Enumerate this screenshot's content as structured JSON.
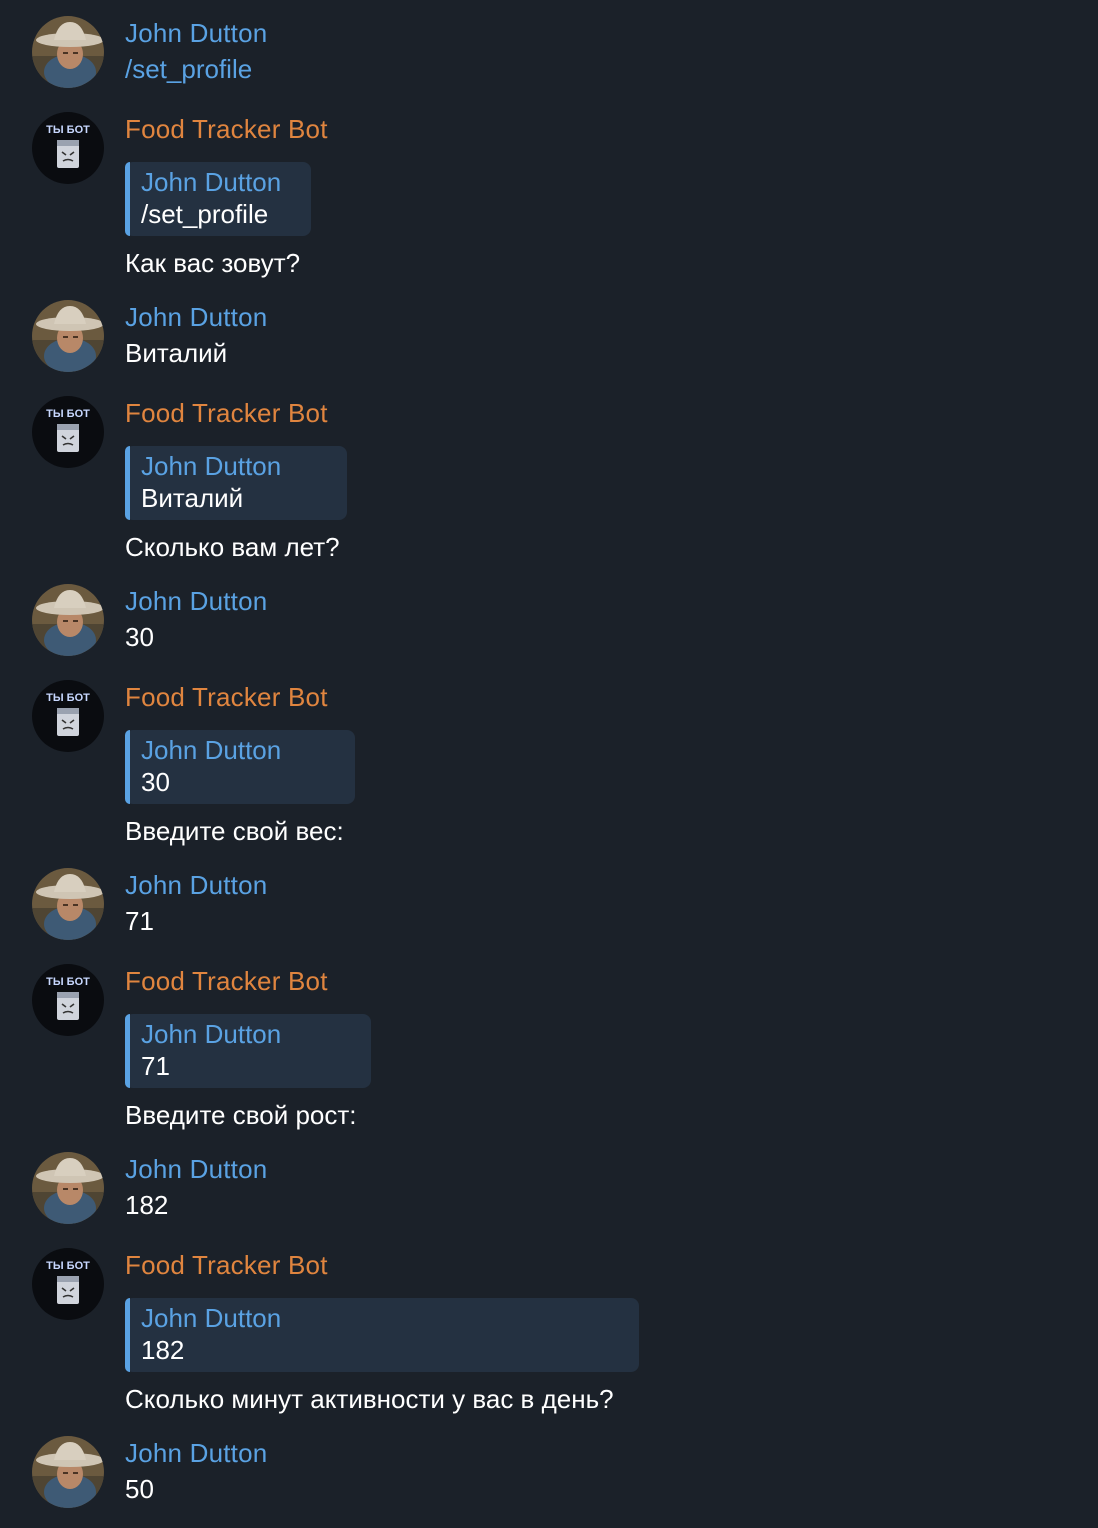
{
  "colors": {
    "background": "#1b2129",
    "user_name": "#5aa2e3",
    "bot_name": "#e0853f",
    "reply_bg": "#243141",
    "reply_bar": "#5aa2e3"
  },
  "avatars": {
    "user": "cowboy-avatar",
    "bot": "bot-avatar",
    "bot_badge": "ТЫ БОТ"
  },
  "messages": [
    {
      "sender": "John Dutton",
      "text": "/set_profile"
    },
    {
      "sender": "Food Tracker Bot",
      "reply_name": "John Dutton",
      "reply_text": "/set_profile",
      "text": "Как вас зовут?"
    },
    {
      "sender": "John Dutton",
      "text": "Виталий"
    },
    {
      "sender": "Food Tracker Bot",
      "reply_name": "John Dutton",
      "reply_text": "Виталий",
      "text": "Сколько вам лет?"
    },
    {
      "sender": "John Dutton",
      "text": "30"
    },
    {
      "sender": "Food Tracker Bot",
      "reply_name": "John Dutton",
      "reply_text": "30",
      "text": "Введите свой вес:"
    },
    {
      "sender": "John Dutton",
      "text": "71"
    },
    {
      "sender": "Food Tracker Bot",
      "reply_name": "John Dutton",
      "reply_text": "71",
      "text": "Введите свой рост:"
    },
    {
      "sender": "John Dutton",
      "text": "182"
    },
    {
      "sender": "Food Tracker Bot",
      "reply_name": "John Dutton",
      "reply_text": "182",
      "text": "Сколько минут активности у вас в день?"
    },
    {
      "sender": "John Dutton",
      "text": "50"
    }
  ]
}
